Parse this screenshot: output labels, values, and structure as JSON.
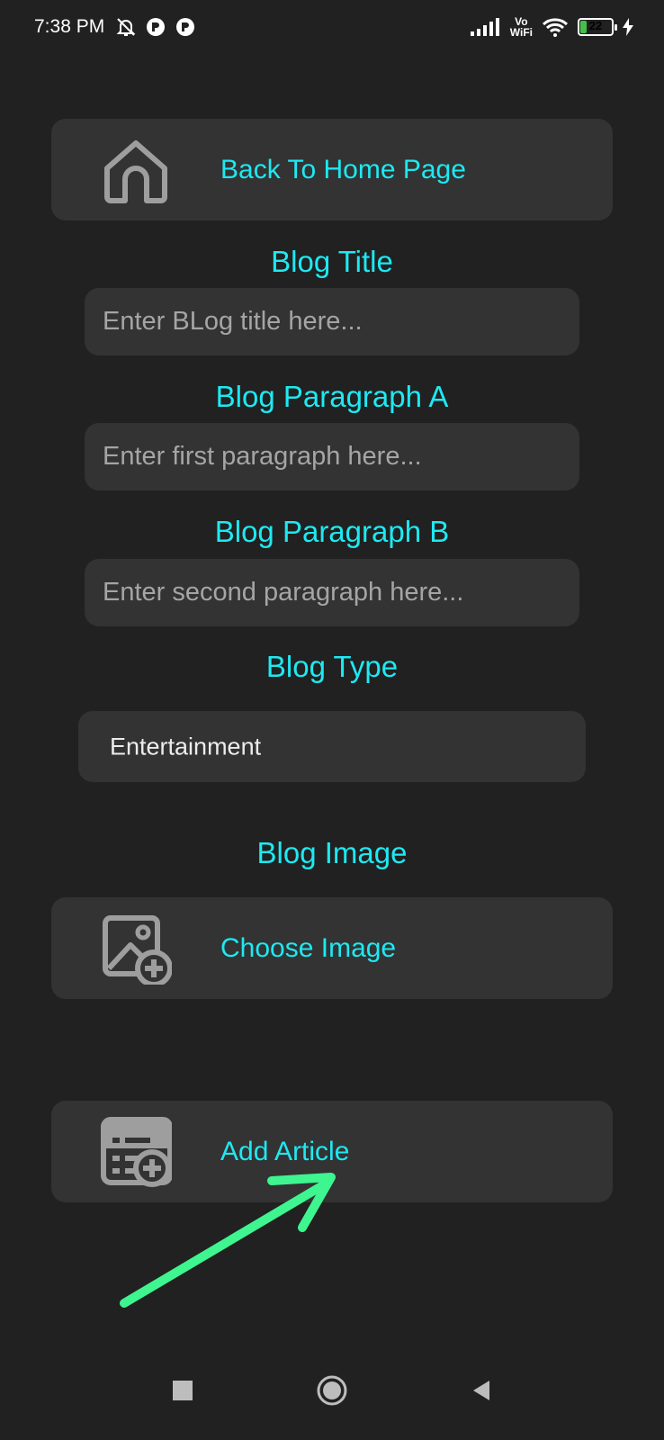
{
  "status_bar": {
    "time": "7:38 PM",
    "vowifi_top": "Vo",
    "vowifi_bottom": "WiFi",
    "battery_level": "22",
    "battery_fraction": 0.22,
    "icons": [
      "mute-bell-icon",
      "app-notification-icon",
      "app-notification-icon",
      "signal-icon",
      "wifi-icon",
      "battery-icon",
      "charging-icon"
    ]
  },
  "home_button": {
    "label": "Back To Home Page",
    "icon": "home-icon"
  },
  "form": {
    "title": {
      "label": "Blog Title",
      "placeholder": "Enter BLog title here..."
    },
    "paragraph_a": {
      "label": "Blog Paragraph A",
      "placeholder": "Enter first paragraph here..."
    },
    "paragraph_b": {
      "label": "Blog Paragraph B",
      "placeholder": "Enter second paragraph here..."
    },
    "type": {
      "label": "Blog Type",
      "value": "Entertainment"
    },
    "image": {
      "label": "Blog Image",
      "button_label": "Choose Image",
      "icon": "image-add-icon"
    }
  },
  "add_article_button": {
    "label": "Add Article",
    "icon": "article-add-icon"
  },
  "colors": {
    "background": "#212121",
    "card": "#333333",
    "accent": "#1de9f2",
    "arrow": "#3ef58f"
  },
  "nav_bar": {
    "icons": [
      "recents-square-icon",
      "home-circle-icon",
      "back-triangle-icon"
    ]
  }
}
